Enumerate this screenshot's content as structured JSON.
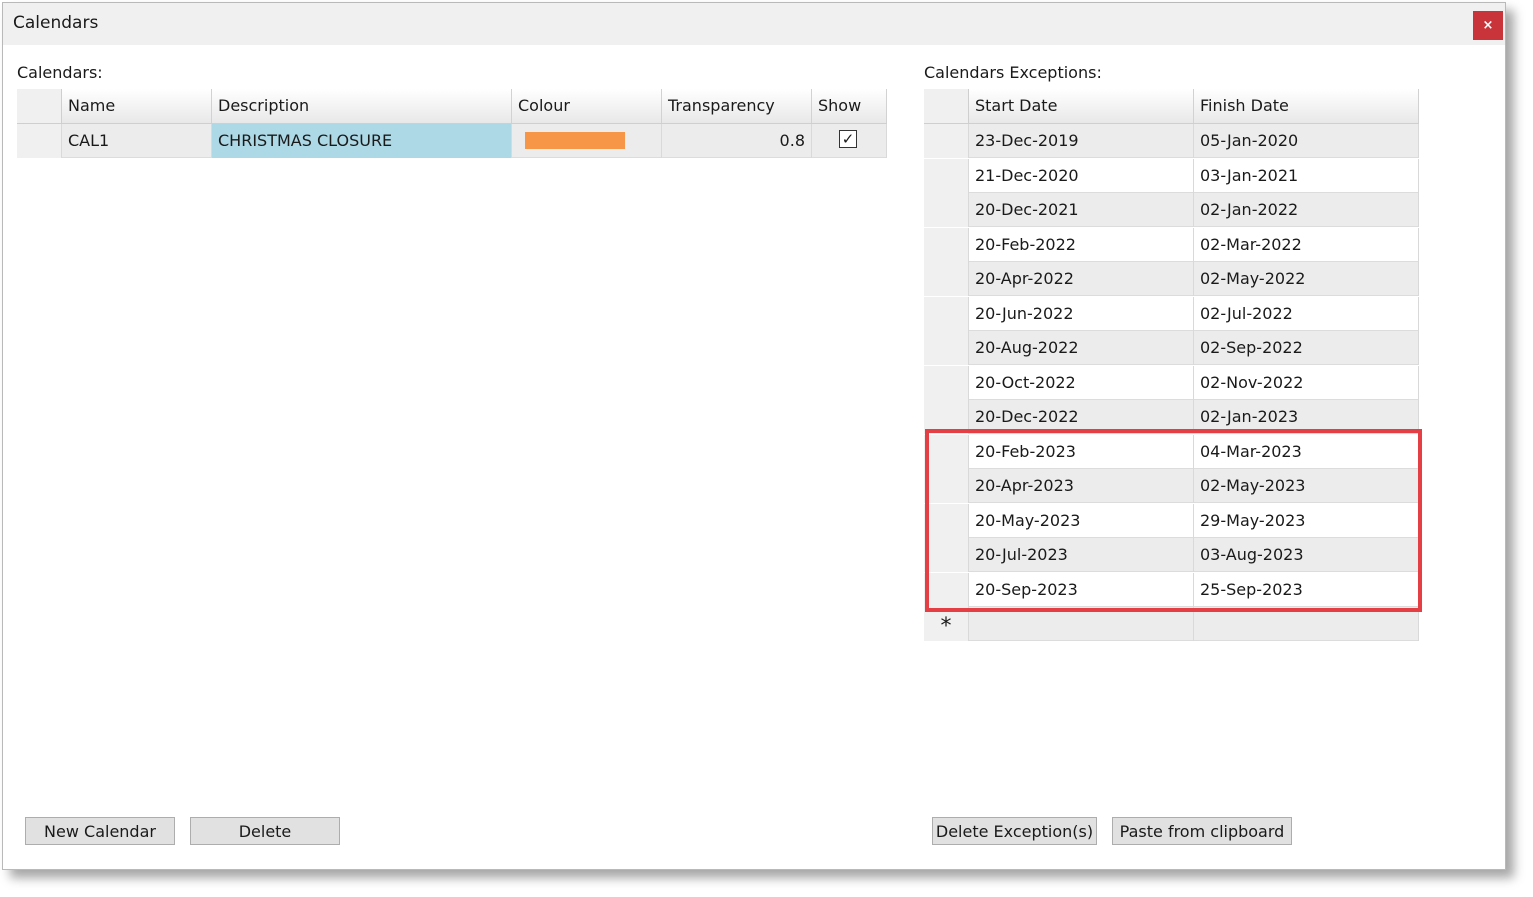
{
  "window": {
    "title": "Calendars",
    "close_label": "×"
  },
  "calendars": {
    "section_label": "Calendars:",
    "headers": [
      "Name",
      "Description",
      "Colour",
      "Transparency",
      "Show"
    ],
    "rows": [
      {
        "name": "CAL1",
        "description": "CHRISTMAS CLOSURE",
        "colour": "#f79646",
        "transparency": "0.8",
        "show": true,
        "check_mark": "✓"
      }
    ],
    "selected_cell_color": "#add8e6"
  },
  "exceptions": {
    "section_label": "Calendars Exceptions:",
    "headers": [
      "Start Date",
      "Finish Date"
    ],
    "rows": [
      {
        "start": "23-Dec-2019",
        "finish": "05-Jan-2020"
      },
      {
        "start": "21-Dec-2020",
        "finish": "03-Jan-2021"
      },
      {
        "start": "20-Dec-2021",
        "finish": "02-Jan-2022"
      },
      {
        "start": "20-Feb-2022",
        "finish": "02-Mar-2022"
      },
      {
        "start": "20-Apr-2022",
        "finish": "02-May-2022"
      },
      {
        "start": "20-Jun-2022",
        "finish": "02-Jul-2022"
      },
      {
        "start": "20-Aug-2022",
        "finish": "02-Sep-2022"
      },
      {
        "start": "20-Oct-2022",
        "finish": "02-Nov-2022"
      },
      {
        "start": "20-Dec-2022",
        "finish": "02-Jan-2023"
      },
      {
        "start": "20-Feb-2023",
        "finish": "04-Mar-2023"
      },
      {
        "start": "20-Apr-2023",
        "finish": "02-May-2023"
      },
      {
        "start": "20-May-2023",
        "finish": "29-May-2023"
      },
      {
        "start": "20-Jul-2023",
        "finish": "03-Aug-2023"
      },
      {
        "start": "20-Sep-2023",
        "finish": "25-Sep-2023"
      }
    ],
    "new_row_marker": "*",
    "highlight_color": "#e53f46"
  },
  "buttons": {
    "new_calendar": "New Calendar",
    "delete": "Delete",
    "delete_exceptions": "Delete Exception(s)",
    "paste_clipboard": "Paste from clipboard"
  }
}
